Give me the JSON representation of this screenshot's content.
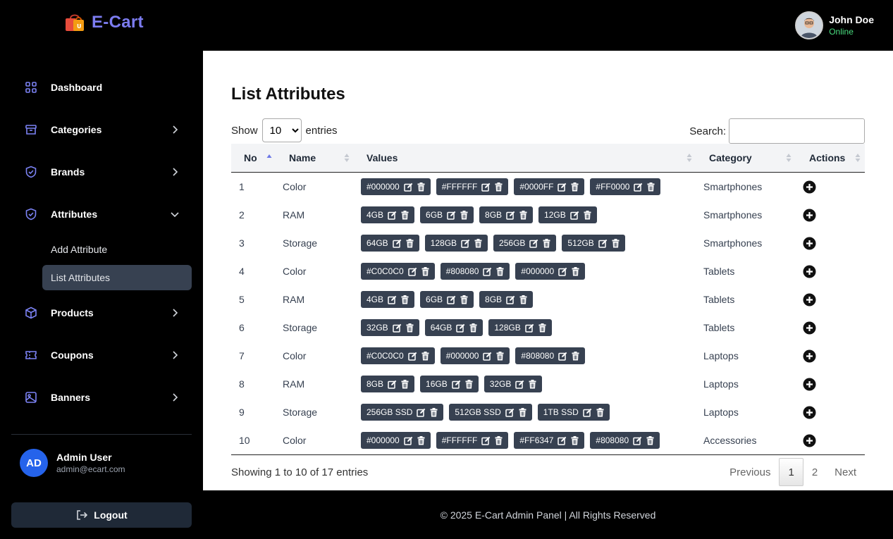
{
  "brand": {
    "name": "E-Cart"
  },
  "user": {
    "name": "John Doe",
    "status": "Online"
  },
  "sidebar": {
    "items": [
      {
        "label": "Dashboard",
        "icon": "grid-icon"
      },
      {
        "label": "Categories",
        "icon": "archive-icon"
      },
      {
        "label": "Brands",
        "icon": "shield-icon"
      },
      {
        "label": "Attributes",
        "icon": "shield-icon",
        "expanded": true
      },
      {
        "label": "Products",
        "icon": "cube-icon"
      },
      {
        "label": "Coupons",
        "icon": "ticket-icon"
      },
      {
        "label": "Banners",
        "icon": "image-icon"
      }
    ],
    "subitems": [
      {
        "label": "Add Attribute"
      },
      {
        "label": "List Attributes",
        "active": true
      }
    ],
    "admin": {
      "initials": "AD",
      "name": "Admin User",
      "email": "admin@ecart.com"
    },
    "logout_label": "Logout"
  },
  "main": {
    "title": "List Attributes",
    "show_label": "Show",
    "entries_label": "entries",
    "entries_value": "10",
    "search_label": "Search:",
    "columns": [
      "No",
      "Name",
      "Values",
      "Category",
      "Actions"
    ],
    "rows": [
      {
        "no": "1",
        "name": "Color",
        "values": [
          "#000000",
          "#FFFFFF",
          "#0000FF",
          "#FF0000"
        ],
        "category": "Smartphones"
      },
      {
        "no": "2",
        "name": "RAM",
        "values": [
          "4GB",
          "6GB",
          "8GB",
          "12GB"
        ],
        "category": "Smartphones"
      },
      {
        "no": "3",
        "name": "Storage",
        "values": [
          "64GB",
          "128GB",
          "256GB",
          "512GB"
        ],
        "category": "Smartphones"
      },
      {
        "no": "4",
        "name": "Color",
        "values": [
          "#C0C0C0",
          "#808080",
          "#000000"
        ],
        "category": "Tablets"
      },
      {
        "no": "5",
        "name": "RAM",
        "values": [
          "4GB",
          "6GB",
          "8GB"
        ],
        "category": "Tablets"
      },
      {
        "no": "6",
        "name": "Storage",
        "values": [
          "32GB",
          "64GB",
          "128GB"
        ],
        "category": "Tablets"
      },
      {
        "no": "7",
        "name": "Color",
        "values": [
          "#C0C0C0",
          "#000000",
          "#808080"
        ],
        "category": "Laptops"
      },
      {
        "no": "8",
        "name": "RAM",
        "values": [
          "8GB",
          "16GB",
          "32GB"
        ],
        "category": "Laptops"
      },
      {
        "no": "9",
        "name": "Storage",
        "values": [
          "256GB SSD",
          "512GB SSD",
          "1TB SSD"
        ],
        "category": "Laptops"
      },
      {
        "no": "10",
        "name": "Color",
        "values": [
          "#000000",
          "#FFFFFF",
          "#FF6347",
          "#808080"
        ],
        "category": "Accessories"
      }
    ],
    "info": "Showing 1 to 10 of 17 entries",
    "pagination": {
      "previous": "Previous",
      "pages": [
        "1",
        "2"
      ],
      "current": "1",
      "next": "Next"
    }
  },
  "footer": {
    "text": "© 2025 E-Cart Admin Panel | All Rights Reserved"
  },
  "colors": {
    "accent": "#7c7cf0",
    "chip": "#374151",
    "online": "#4ade80",
    "admin_avatar": "#2563eb"
  }
}
